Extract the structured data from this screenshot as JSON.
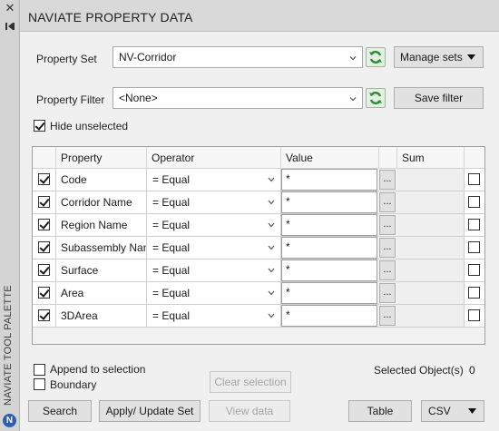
{
  "palette": {
    "close_glyph": "✕",
    "title": "NAVIATE TOOL PALETTE",
    "logo_letter": "N"
  },
  "window": {
    "title": "NAVIATE PROPERTY DATA"
  },
  "property_set": {
    "label": "Property Set",
    "value": "NV-Corridor",
    "manage_label": "Manage sets"
  },
  "property_filter": {
    "label": "Property Filter",
    "value": "<None>",
    "save_label": "Save filter"
  },
  "hide_unselected": {
    "label": "Hide unselected",
    "checked": true
  },
  "grid": {
    "headers": {
      "property": "Property",
      "operator": "Operator",
      "value": "Value",
      "sum": "Sum"
    },
    "rows": [
      {
        "checked": true,
        "property": "Code",
        "operator": "= Equal",
        "value": "*",
        "ellipsis": "...",
        "sum_checked": false
      },
      {
        "checked": true,
        "property": "Corridor Name",
        "operator": "= Equal",
        "value": "*",
        "ellipsis": "...",
        "sum_checked": false
      },
      {
        "checked": true,
        "property": "Region Name",
        "operator": "= Equal",
        "value": "*",
        "ellipsis": "...",
        "sum_checked": false
      },
      {
        "checked": true,
        "property": "Subassembly Nan",
        "operator": "= Equal",
        "value": "*",
        "ellipsis": "...",
        "sum_checked": false
      },
      {
        "checked": true,
        "property": "Surface",
        "operator": "= Equal",
        "value": "*",
        "ellipsis": "...",
        "sum_checked": false
      },
      {
        "checked": true,
        "property": "Area",
        "operator": "= Equal",
        "value": "*",
        "ellipsis": "...",
        "sum_checked": false
      },
      {
        "checked": true,
        "property": "3DArea",
        "operator": "= Equal",
        "value": "*",
        "ellipsis": "...",
        "sum_checked": false
      }
    ]
  },
  "options": {
    "append_label": "Append to selection",
    "append_checked": false,
    "boundary_label": "Boundary",
    "boundary_checked": false,
    "clear_selection_label": "Clear selection",
    "selected_objects_label": "Selected Object(s)",
    "selected_objects_count": "0"
  },
  "footer": {
    "search_label": "Search",
    "apply_label": "Apply/ Update Set",
    "view_data_label": "View data",
    "table_label": "Table",
    "export_format": "CSV"
  },
  "colors": {
    "refresh_green": "#2e8b2e",
    "logo_blue": "#2b5fb0"
  }
}
